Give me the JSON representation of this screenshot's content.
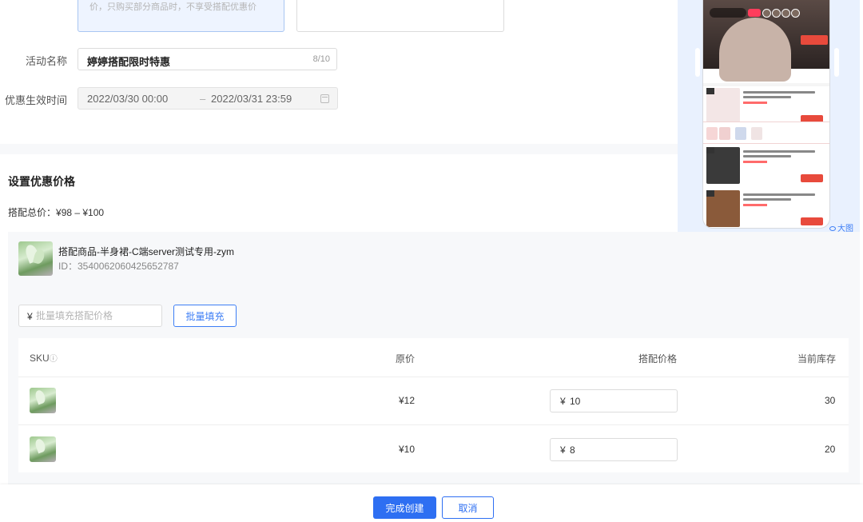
{
  "form": {
    "desc_text": "价，只购买部分商品时，不享受搭配优惠价",
    "name_label": "活动名称",
    "name_value": "婷婷搭配限时特惠",
    "name_count": "8/10",
    "time_label": "优惠生效时间",
    "time_start": "2022/03/30 00:00",
    "time_sep": "–",
    "time_end": "2022/03/31 23:59",
    "calendar_icon": "calendar-icon"
  },
  "pricing": {
    "section_title": "设置优惠价格",
    "total_label": "搭配总价：",
    "total_value": "¥98 – ¥100"
  },
  "product": {
    "name": "搭配商品-半身裙-C端server测试专用-zym",
    "id": "ID：3540062060425652787",
    "batch_currency": "¥",
    "batch_placeholder": "批量填充搭配价格",
    "batch_button": "批量填充"
  },
  "table": {
    "headers": {
      "sku": "SKU",
      "sku_help_icon": "ⓘ",
      "original": "原价",
      "bundle": "搭配价格",
      "stock": "当前库存"
    },
    "rows": [
      {
        "original": "¥12",
        "currency": "¥",
        "bundle_price": "10",
        "stock": "30"
      },
      {
        "original": "¥10",
        "currency": "¥",
        "bundle_price": "8",
        "stock": "20"
      }
    ]
  },
  "preview": {
    "big_view_label": "大图",
    "icon": "eye-icon"
  },
  "footer": {
    "confirm": "完成创建",
    "cancel": "取消"
  },
  "colors": {
    "primary": "#2e6ff2",
    "link": "#3d7ef5",
    "preview_bg": "#e9f1fe"
  }
}
